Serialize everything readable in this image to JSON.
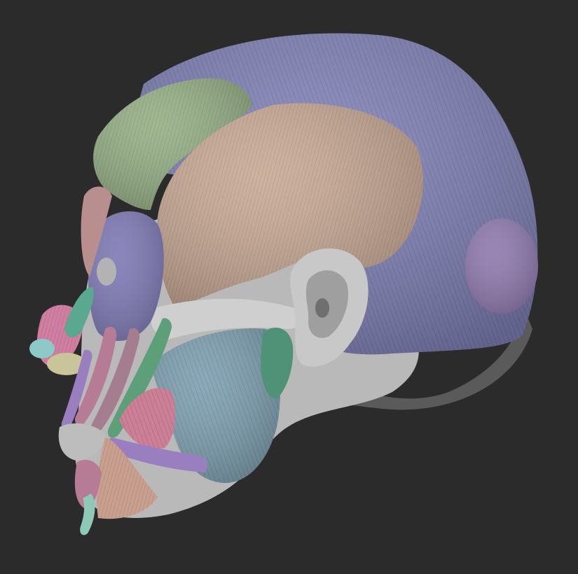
{
  "scene": {
    "subject": "anatomical-head-model",
    "view": "left-profile",
    "background_color": "#2b2b2b"
  },
  "colors": {
    "cranium_cap": "#7f80b5",
    "temporalis": "#c9a995",
    "frontalis": "#95af85",
    "occipitalis": "#8e78ad",
    "orbicularis_oculi": "#7d78b4",
    "masseter": "#7d9fb0",
    "nasalis": "#d07fa2",
    "zygomaticus": "#5c9f78",
    "levator_labii": "#b67b95",
    "mentalis": "#c9a08f",
    "buccinator": "#cd7f98",
    "platysma_band": "#9a7fc0",
    "sternocleidomastoid": "#4f9278",
    "skull_bone": "#b9b9b9",
    "ear": "#c8c8c8",
    "neck_shadow": "#5a5a5a"
  },
  "layers": [
    "neck-base",
    "skull-bone",
    "cranium-cap",
    "occipitalis-patch",
    "frontalis-muscle",
    "temporalis-muscle",
    "masseter-muscle",
    "orbicularis-oculi",
    "facial-muscles",
    "ear"
  ]
}
